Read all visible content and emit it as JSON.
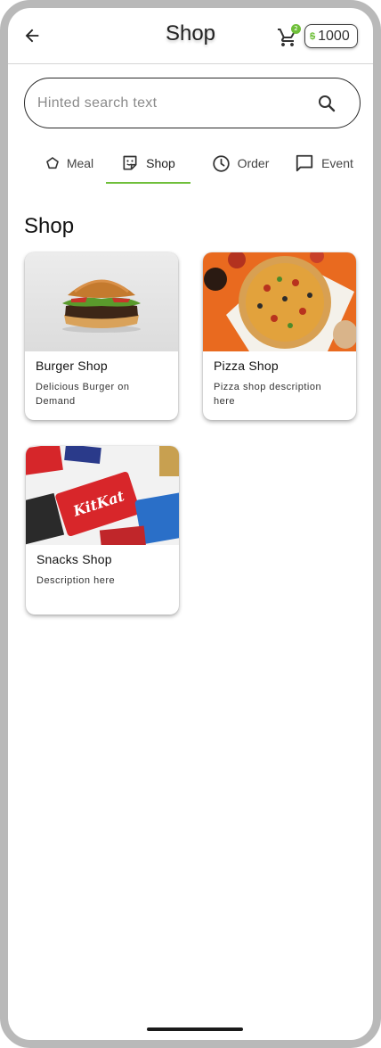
{
  "header": {
    "title": "Shop",
    "cart_count": "2",
    "coin_symbol": "$",
    "coin_balance": "1000"
  },
  "search": {
    "value": "",
    "placeholder": "Hinted search text"
  },
  "tabs": [
    {
      "label": "Meal",
      "icon": "pentagon-icon",
      "active": false
    },
    {
      "label": "Shop",
      "icon": "storefront-sticker-icon",
      "active": true
    },
    {
      "label": "Order",
      "icon": "clock-icon",
      "active": false
    },
    {
      "label": "Event",
      "icon": "chat-bubble-icon",
      "active": false
    }
  ],
  "accent_color": "#6fbf3a",
  "section": {
    "title": "Shop",
    "shops": [
      {
        "name": "Burger Shop",
        "description": "Delicious Burger on Demand",
        "image": "burger-photo"
      },
      {
        "name": "Pizza Shop",
        "description": "Pizza shop description here",
        "image": "pizza-photo"
      },
      {
        "name": "Snacks Shop",
        "description": "Description here",
        "image": "candy-bars-photo"
      }
    ]
  }
}
